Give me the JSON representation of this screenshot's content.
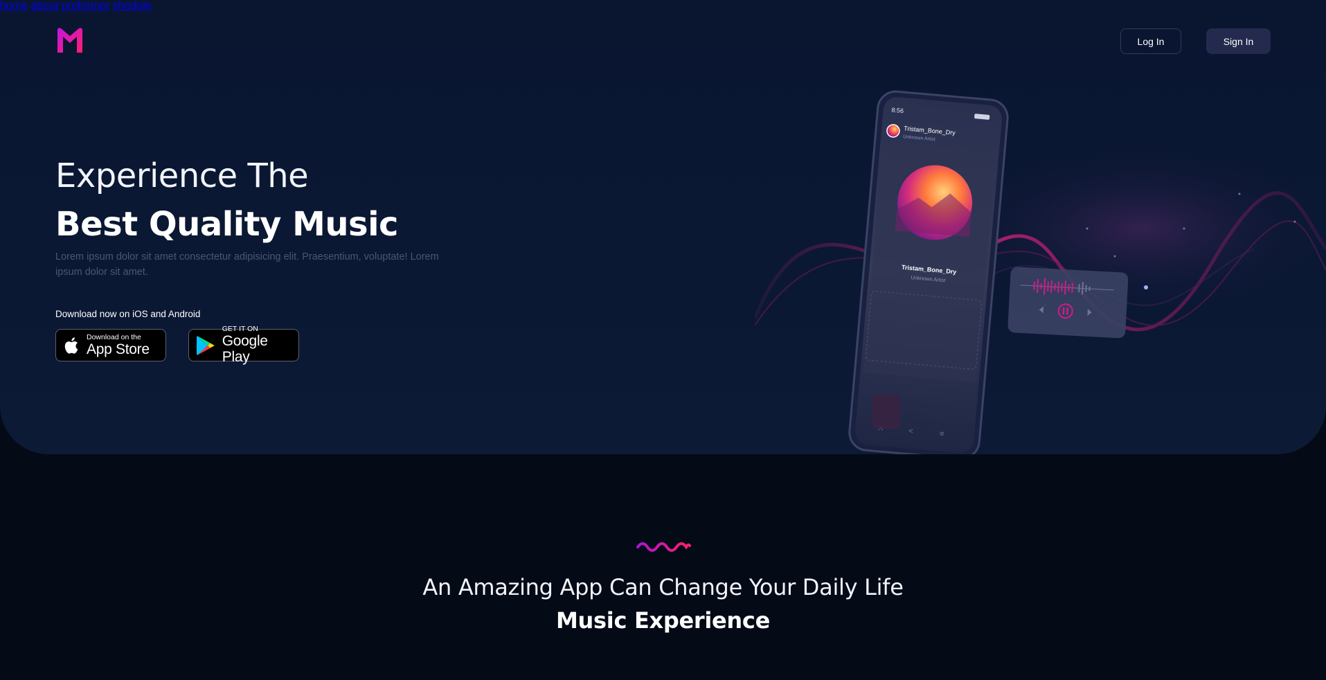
{
  "nav": {
    "items": [
      {
        "label": "home"
      },
      {
        "label": "about"
      },
      {
        "label": "preformer"
      },
      {
        "label": "shedule"
      }
    ],
    "login_label": "Log In",
    "signin_label": "Sign In"
  },
  "hero": {
    "title_light": "Experience The",
    "title_bold": "Best Quality Music",
    "description": "Lorem ipsum dolor sit amet consectetur adipisicing elit. Praesentium, voluptate! Lorem ipsum dolor sit amet.",
    "download_label": "Download now on iOS and Android",
    "app_store": {
      "small": "Download on the",
      "big": "App Store"
    },
    "google_play": {
      "small": "GET IT ON",
      "big": "Google Play"
    }
  },
  "phone": {
    "time": "8:56",
    "track_title": "Tristam_Bone_Dry",
    "track_artist": "Unknown Artist"
  },
  "section": {
    "title_light": "An Amazing App Can Change Your Daily Life",
    "title_bold": "Music Experience"
  },
  "colors": {
    "accent_pink": "#e0188a",
    "accent_magenta": "#b112d8",
    "background": "#050a17",
    "hero_bg": "#0b1834",
    "button_dark": "#232a4d"
  }
}
